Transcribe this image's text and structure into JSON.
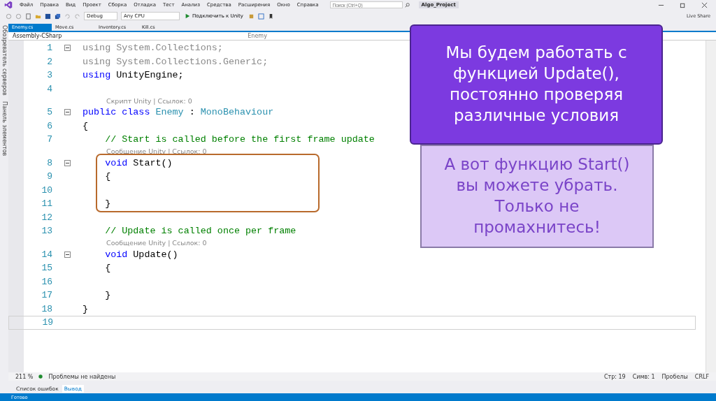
{
  "menu": [
    "Файл",
    "Правка",
    "Вид",
    "Проект",
    "Сборка",
    "Отладка",
    "Тест",
    "Анализ",
    "Средства",
    "Расширения",
    "Окно",
    "Справка"
  ],
  "search": {
    "placeholder": "Поиск (Ctrl+Q)"
  },
  "window": {
    "title": "Algo_Project"
  },
  "toolbar": {
    "configuration": "Debug",
    "platform": "Any CPU",
    "run_button": "Подключить к Unity",
    "live_share": "Live Share"
  },
  "side_panels": [
    "Обозреватель серверов",
    "Панель элементов"
  ],
  "tabs": [
    {
      "label": "Enemy.cs",
      "selected": true
    },
    {
      "label": "Move.cs",
      "selected": false
    },
    {
      "label": "Inventory.cs",
      "selected": false
    },
    {
      "label": "Kill.cs",
      "selected": false
    }
  ],
  "nav_bar": {
    "project": "Assembly-CSharp",
    "class": "Enemy"
  },
  "code_lines": [
    {
      "number": "1",
      "fold": true,
      "tokens": [
        {
          "text": "using System.Collections;",
          "kind": "dim"
        }
      ]
    },
    {
      "number": "2",
      "fold": false,
      "tokens": [
        {
          "text": "using System.Collections.Generic;",
          "kind": "dim"
        }
      ]
    },
    {
      "number": "3",
      "fold": false,
      "tokens": [
        {
          "text": "using",
          "kind": "keyword"
        },
        {
          "text": " UnityEngine;",
          "kind": "plain"
        }
      ]
    },
    {
      "number": "4",
      "fold": false
    },
    {
      "number": "5",
      "fold": true,
      "lens": "Скрипт Unity | Ссылок: 0",
      "tokens": [
        {
          "text": "public class",
          "kind": "keyword"
        },
        {
          "text": " Enemy",
          "kind": "type"
        },
        {
          "text": " : ",
          "kind": "plain"
        },
        {
          "text": "MonoBehaviour",
          "kind": "type"
        }
      ]
    },
    {
      "number": "6",
      "fold": false,
      "tokens": [
        {
          "text": "{",
          "kind": "plain"
        }
      ]
    },
    {
      "number": "7",
      "fold": false,
      "tokens": [
        {
          "text": "    // Start is called before the first frame update",
          "kind": "comment"
        }
      ]
    },
    {
      "number": "8",
      "fold": true,
      "lens": "Сообщение Unity | Ссылок: 0",
      "tokens": [
        {
          "text": "    void",
          "kind": "keyword"
        },
        {
          "text": " Start()",
          "kind": "plain"
        }
      ]
    },
    {
      "number": "9",
      "fold": false,
      "tokens": [
        {
          "text": "    {",
          "kind": "plain"
        }
      ]
    },
    {
      "number": "10",
      "fold": false
    },
    {
      "number": "11",
      "fold": false,
      "tokens": [
        {
          "text": "    }",
          "kind": "plain"
        }
      ]
    },
    {
      "number": "12",
      "fold": false
    },
    {
      "number": "13",
      "fold": false,
      "tokens": [
        {
          "text": "    // Update is called once per frame",
          "kind": "comment"
        }
      ]
    },
    {
      "number": "14",
      "fold": true,
      "lens": "Сообщение Unity | Ссылок: 0",
      "tokens": [
        {
          "text": "    void",
          "kind": "keyword"
        },
        {
          "text": " Update()",
          "kind": "plain"
        }
      ]
    },
    {
      "number": "15",
      "fold": false,
      "tokens": [
        {
          "text": "    {",
          "kind": "plain"
        }
      ]
    },
    {
      "number": "16",
      "fold": false
    },
    {
      "number": "17",
      "fold": false,
      "tokens": [
        {
          "text": "    }",
          "kind": "plain"
        }
      ]
    },
    {
      "number": "18",
      "fold": false,
      "tokens": [
        {
          "text": "}",
          "kind": "plain"
        }
      ]
    },
    {
      "number": "19",
      "fold": false,
      "current": true
    }
  ],
  "callouts": [
    {
      "kind": "primary",
      "text": "Мы будем работать с функцией Update(), постоянно проверяя различные условия"
    },
    {
      "kind": "secondary",
      "text": "А вот функцию Start() вы можете убрать. Только не промахнитесь!"
    }
  ],
  "editor_status": {
    "zoom": "211 %",
    "problems": "Проблемы не найдены",
    "line": "Стр: 19",
    "column": "Симв: 1",
    "whitespace": "Пробелы",
    "line_ending": "CRLF"
  },
  "bottom_tabs": [
    {
      "label": "Список ошибок",
      "selected": false
    },
    {
      "label": "Вывод",
      "selected": true
    }
  ],
  "status_bar": {
    "text": "Готово"
  }
}
